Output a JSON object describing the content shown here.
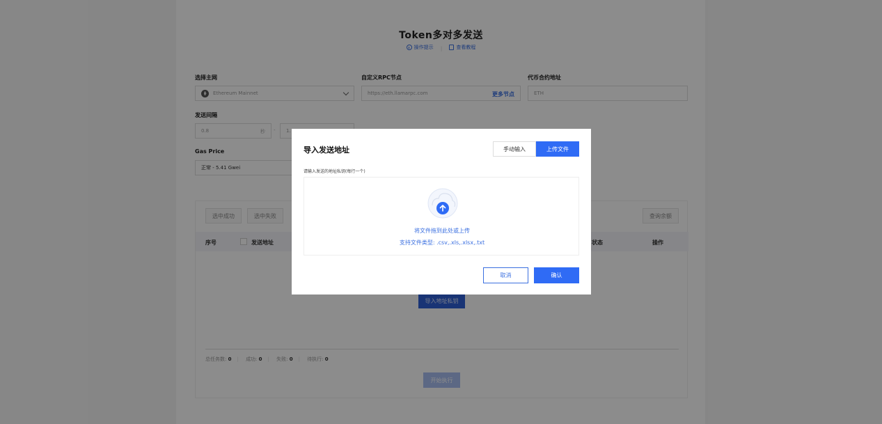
{
  "page": {
    "title": "Token多对多发送",
    "links": {
      "tips": "操作提示",
      "tutorial": "查看教程"
    }
  },
  "form": {
    "network": {
      "label": "选择主网",
      "value": "Ethereum Mainnet"
    },
    "rpc": {
      "label": "自定义RPC节点",
      "value": "https://eth.llamarpc.com",
      "more": "更多节点"
    },
    "contract": {
      "label": "代币合约地址",
      "value": "ETH"
    },
    "interval": {
      "label": "发送间隔",
      "from": "0.8",
      "unit": "秒",
      "sep": "-",
      "to": "1."
    },
    "gas": {
      "label": "Gas Price",
      "value": "正常 - 5.41 Gwei"
    }
  },
  "table": {
    "chips": [
      "选中成功",
      "选中失败"
    ],
    "query_balance": "查询余额",
    "headers": {
      "index": "序号",
      "address": "发送地址",
      "status": "状态",
      "action": "操作"
    },
    "import_label": "导入地址私钥",
    "stats": [
      {
        "label": "总任务数:",
        "value": "0"
      },
      {
        "label": "成功:",
        "value": "0"
      },
      {
        "label": "失败:",
        "value": "0"
      },
      {
        "label": "待执行:",
        "value": "0"
      }
    ],
    "start_label": "开始执行"
  },
  "modal": {
    "title": "导入发送地址",
    "tab_manual": "手动输入",
    "tab_upload": "上传文件",
    "hint": "请输入发送的地址私钥(每行一个)",
    "drop_line1": "将文件拖到此处或上传",
    "drop_line2": "支持文件类型: .csv,.xls,.xlsx,.txt",
    "cancel": "取消",
    "confirm": "确认"
  },
  "colors": {
    "accent": "#2f6bf5",
    "link": "#3a6fe0"
  }
}
